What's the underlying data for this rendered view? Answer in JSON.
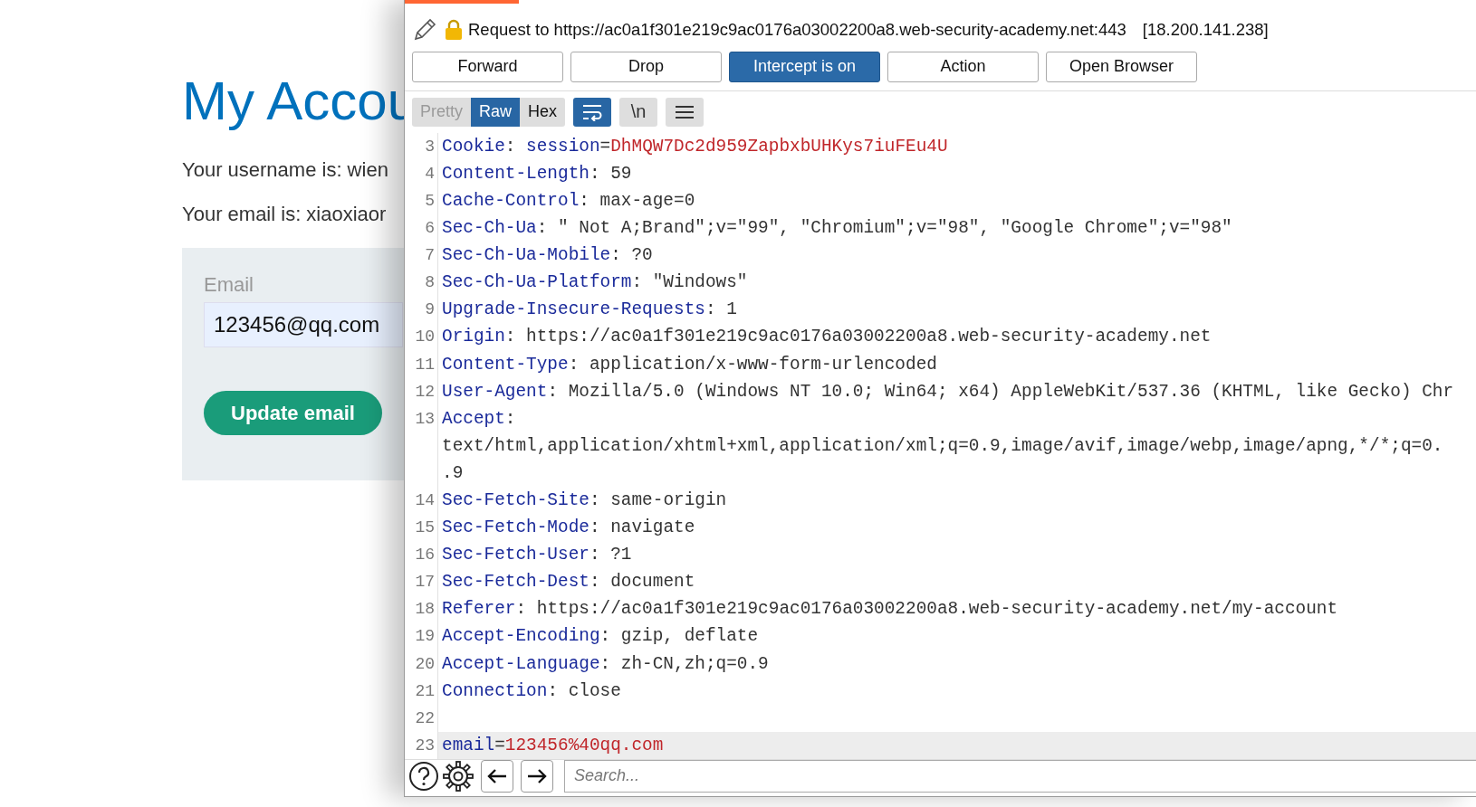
{
  "web_page": {
    "heading": "My Accou",
    "username_line": "Your username is: wien",
    "email_line": "Your email is: xiaoxiaor",
    "form": {
      "label": "Email",
      "value": "123456@qq.com",
      "button": "Update email"
    }
  },
  "intercept_panel": {
    "request_line": "Request to https://ac0a1f301e219c9ac0176a03002200a8.web-security-academy.net:443",
    "ip": "[18.200.141.238]",
    "buttons": [
      {
        "label": "Forward",
        "selected": false
      },
      {
        "label": "Drop",
        "selected": false
      },
      {
        "label": "Intercept is on",
        "selected": true
      },
      {
        "label": "Action",
        "selected": false
      },
      {
        "label": "Open Browser",
        "selected": false
      }
    ],
    "view_tabs": [
      {
        "label": "Pretty",
        "selected": false,
        "disabled": true
      },
      {
        "label": "Raw",
        "selected": true,
        "disabled": false
      },
      {
        "label": "Hex",
        "selected": false,
        "disabled": false
      }
    ],
    "tools": [
      {
        "kind": "wrap",
        "on": true
      },
      {
        "kind": "newline",
        "label": "\\n",
        "on": false
      },
      {
        "kind": "menu",
        "on": false
      }
    ],
    "lines": [
      {
        "number": "3",
        "highlighted": false,
        "segments": [
          {
            "kind": "name",
            "text": "Cookie"
          },
          {
            "kind": "plain",
            "text": ": "
          },
          {
            "kind": "name",
            "text": "session"
          },
          {
            "kind": "plain",
            "text": "="
          },
          {
            "kind": "value",
            "text": "DhMQW7Dc2d959ZapbxbUHKys7iuFEu4U"
          }
        ]
      },
      {
        "number": "4",
        "highlighted": false,
        "segments": [
          {
            "kind": "name",
            "text": "Content-Length"
          },
          {
            "kind": "plain",
            "text": ": 59"
          }
        ]
      },
      {
        "number": "5",
        "highlighted": false,
        "segments": [
          {
            "kind": "name",
            "text": "Cache-Control"
          },
          {
            "kind": "plain",
            "text": ": max-age=0"
          }
        ]
      },
      {
        "number": "6",
        "highlighted": false,
        "segments": [
          {
            "kind": "name",
            "text": "Sec-Ch-Ua"
          },
          {
            "kind": "plain",
            "text": ": \" Not A;Brand\";v=\"99\", \"Chromium\";v=\"98\", \"Google Chrome\";v=\"98\""
          }
        ]
      },
      {
        "number": "7",
        "highlighted": false,
        "segments": [
          {
            "kind": "name",
            "text": "Sec-Ch-Ua-Mobile"
          },
          {
            "kind": "plain",
            "text": ": ?0"
          }
        ]
      },
      {
        "number": "8",
        "highlighted": false,
        "segments": [
          {
            "kind": "name",
            "text": "Sec-Ch-Ua-Platform"
          },
          {
            "kind": "plain",
            "text": ": \"Windows\""
          }
        ]
      },
      {
        "number": "9",
        "highlighted": false,
        "segments": [
          {
            "kind": "name",
            "text": "Upgrade-Insecure-Requests"
          },
          {
            "kind": "plain",
            "text": ": 1"
          }
        ]
      },
      {
        "number": "10",
        "highlighted": false,
        "segments": [
          {
            "kind": "name",
            "text": "Origin"
          },
          {
            "kind": "plain",
            "text": ": https://ac0a1f301e219c9ac0176a03002200a8.web-security-academy.net"
          }
        ]
      },
      {
        "number": "11",
        "highlighted": false,
        "segments": [
          {
            "kind": "name",
            "text": "Content-Type"
          },
          {
            "kind": "plain",
            "text": ": application/x-www-form-urlencoded"
          }
        ]
      },
      {
        "number": "12",
        "highlighted": false,
        "segments": [
          {
            "kind": "name",
            "text": "User-Agent"
          },
          {
            "kind": "plain",
            "text": ": Mozilla/5.0 (Windows NT 10.0; Win64; x64) AppleWebKit/537.36 (KHTML, like Gecko) Chr"
          }
        ]
      },
      {
        "number": "13",
        "highlighted": false,
        "segments": [
          {
            "kind": "name",
            "text": "Accept"
          },
          {
            "kind": "plain",
            "text": ":"
          }
        ]
      },
      {
        "highlighted": false,
        "segments": [
          {
            "kind": "plain",
            "text": "text/html,application/xhtml+xml,application/xml;q=0.9,image/avif,image/webp,image/apng,*/*;q=0."
          }
        ]
      },
      {
        "highlighted": false,
        "segments": [
          {
            "kind": "plain",
            "text": ".9"
          }
        ]
      },
      {
        "number": "14",
        "highlighted": false,
        "segments": [
          {
            "kind": "name",
            "text": "Sec-Fetch-Site"
          },
          {
            "kind": "plain",
            "text": ": same-origin"
          }
        ]
      },
      {
        "number": "15",
        "highlighted": false,
        "segments": [
          {
            "kind": "name",
            "text": "Sec-Fetch-Mode"
          },
          {
            "kind": "plain",
            "text": ": navigate"
          }
        ]
      },
      {
        "number": "16",
        "highlighted": false,
        "segments": [
          {
            "kind": "name",
            "text": "Sec-Fetch-User"
          },
          {
            "kind": "plain",
            "text": ": ?1"
          }
        ]
      },
      {
        "number": "17",
        "highlighted": false,
        "segments": [
          {
            "kind": "name",
            "text": "Sec-Fetch-Dest"
          },
          {
            "kind": "plain",
            "text": ": document"
          }
        ]
      },
      {
        "number": "18",
        "highlighted": false,
        "segments": [
          {
            "kind": "name",
            "text": "Referer"
          },
          {
            "kind": "plain",
            "text": ": https://ac0a1f301e219c9ac0176a03002200a8.web-security-academy.net/my-account"
          }
        ]
      },
      {
        "number": "19",
        "highlighted": false,
        "segments": [
          {
            "kind": "name",
            "text": "Accept-Encoding"
          },
          {
            "kind": "plain",
            "text": ": gzip, deflate"
          }
        ]
      },
      {
        "number": "20",
        "highlighted": false,
        "segments": [
          {
            "kind": "name",
            "text": "Accept-Language"
          },
          {
            "kind": "plain",
            "text": ": zh-CN,zh;q=0.9"
          }
        ]
      },
      {
        "number": "21",
        "highlighted": false,
        "segments": [
          {
            "kind": "name",
            "text": "Connection"
          },
          {
            "kind": "plain",
            "text": ": close"
          }
        ]
      },
      {
        "number": "22",
        "highlighted": false
      },
      {
        "number": "23",
        "highlighted": true,
        "segments": [
          {
            "kind": "name",
            "text": "email"
          },
          {
            "kind": "plain",
            "text": "="
          },
          {
            "kind": "value",
            "text": "123456%40qq.com"
          }
        ]
      }
    ],
    "search": {
      "placeholder": "Search..."
    }
  }
}
